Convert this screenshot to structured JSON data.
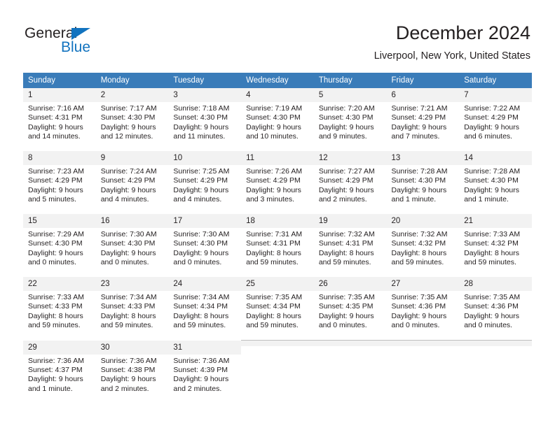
{
  "brand": {
    "name_part1": "General",
    "name_part2": "Blue",
    "accent_color": "#1273bf"
  },
  "header": {
    "month_title": "December 2024",
    "location": "Liverpool, New York, United States"
  },
  "theme": {
    "header_row_bg": "#3a7cb9",
    "daynum_bg": "#f2f2f2",
    "grid_line": "#bfbfbf",
    "text": "#231f20"
  },
  "weekdays": [
    "Sunday",
    "Monday",
    "Tuesday",
    "Wednesday",
    "Thursday",
    "Friday",
    "Saturday"
  ],
  "weeks": [
    [
      {
        "day": "1",
        "sunrise": "Sunrise: 7:16 AM",
        "sunset": "Sunset: 4:31 PM",
        "daylight_line1": "Daylight: 9 hours",
        "daylight_line2": "and 14 minutes."
      },
      {
        "day": "2",
        "sunrise": "Sunrise: 7:17 AM",
        "sunset": "Sunset: 4:30 PM",
        "daylight_line1": "Daylight: 9 hours",
        "daylight_line2": "and 12 minutes."
      },
      {
        "day": "3",
        "sunrise": "Sunrise: 7:18 AM",
        "sunset": "Sunset: 4:30 PM",
        "daylight_line1": "Daylight: 9 hours",
        "daylight_line2": "and 11 minutes."
      },
      {
        "day": "4",
        "sunrise": "Sunrise: 7:19 AM",
        "sunset": "Sunset: 4:30 PM",
        "daylight_line1": "Daylight: 9 hours",
        "daylight_line2": "and 10 minutes."
      },
      {
        "day": "5",
        "sunrise": "Sunrise: 7:20 AM",
        "sunset": "Sunset: 4:30 PM",
        "daylight_line1": "Daylight: 9 hours",
        "daylight_line2": "and 9 minutes."
      },
      {
        "day": "6",
        "sunrise": "Sunrise: 7:21 AM",
        "sunset": "Sunset: 4:29 PM",
        "daylight_line1": "Daylight: 9 hours",
        "daylight_line2": "and 7 minutes."
      },
      {
        "day": "7",
        "sunrise": "Sunrise: 7:22 AM",
        "sunset": "Sunset: 4:29 PM",
        "daylight_line1": "Daylight: 9 hours",
        "daylight_line2": "and 6 minutes."
      }
    ],
    [
      {
        "day": "8",
        "sunrise": "Sunrise: 7:23 AM",
        "sunset": "Sunset: 4:29 PM",
        "daylight_line1": "Daylight: 9 hours",
        "daylight_line2": "and 5 minutes."
      },
      {
        "day": "9",
        "sunrise": "Sunrise: 7:24 AM",
        "sunset": "Sunset: 4:29 PM",
        "daylight_line1": "Daylight: 9 hours",
        "daylight_line2": "and 4 minutes."
      },
      {
        "day": "10",
        "sunrise": "Sunrise: 7:25 AM",
        "sunset": "Sunset: 4:29 PM",
        "daylight_line1": "Daylight: 9 hours",
        "daylight_line2": "and 4 minutes."
      },
      {
        "day": "11",
        "sunrise": "Sunrise: 7:26 AM",
        "sunset": "Sunset: 4:29 PM",
        "daylight_line1": "Daylight: 9 hours",
        "daylight_line2": "and 3 minutes."
      },
      {
        "day": "12",
        "sunrise": "Sunrise: 7:27 AM",
        "sunset": "Sunset: 4:29 PM",
        "daylight_line1": "Daylight: 9 hours",
        "daylight_line2": "and 2 minutes."
      },
      {
        "day": "13",
        "sunrise": "Sunrise: 7:28 AM",
        "sunset": "Sunset: 4:30 PM",
        "daylight_line1": "Daylight: 9 hours",
        "daylight_line2": "and 1 minute."
      },
      {
        "day": "14",
        "sunrise": "Sunrise: 7:28 AM",
        "sunset": "Sunset: 4:30 PM",
        "daylight_line1": "Daylight: 9 hours",
        "daylight_line2": "and 1 minute."
      }
    ],
    [
      {
        "day": "15",
        "sunrise": "Sunrise: 7:29 AM",
        "sunset": "Sunset: 4:30 PM",
        "daylight_line1": "Daylight: 9 hours",
        "daylight_line2": "and 0 minutes."
      },
      {
        "day": "16",
        "sunrise": "Sunrise: 7:30 AM",
        "sunset": "Sunset: 4:30 PM",
        "daylight_line1": "Daylight: 9 hours",
        "daylight_line2": "and 0 minutes."
      },
      {
        "day": "17",
        "sunrise": "Sunrise: 7:30 AM",
        "sunset": "Sunset: 4:30 PM",
        "daylight_line1": "Daylight: 9 hours",
        "daylight_line2": "and 0 minutes."
      },
      {
        "day": "18",
        "sunrise": "Sunrise: 7:31 AM",
        "sunset": "Sunset: 4:31 PM",
        "daylight_line1": "Daylight: 8 hours",
        "daylight_line2": "and 59 minutes."
      },
      {
        "day": "19",
        "sunrise": "Sunrise: 7:32 AM",
        "sunset": "Sunset: 4:31 PM",
        "daylight_line1": "Daylight: 8 hours",
        "daylight_line2": "and 59 minutes."
      },
      {
        "day": "20",
        "sunrise": "Sunrise: 7:32 AM",
        "sunset": "Sunset: 4:32 PM",
        "daylight_line1": "Daylight: 8 hours",
        "daylight_line2": "and 59 minutes."
      },
      {
        "day": "21",
        "sunrise": "Sunrise: 7:33 AM",
        "sunset": "Sunset: 4:32 PM",
        "daylight_line1": "Daylight: 8 hours",
        "daylight_line2": "and 59 minutes."
      }
    ],
    [
      {
        "day": "22",
        "sunrise": "Sunrise: 7:33 AM",
        "sunset": "Sunset: 4:33 PM",
        "daylight_line1": "Daylight: 8 hours",
        "daylight_line2": "and 59 minutes."
      },
      {
        "day": "23",
        "sunrise": "Sunrise: 7:34 AM",
        "sunset": "Sunset: 4:33 PM",
        "daylight_line1": "Daylight: 8 hours",
        "daylight_line2": "and 59 minutes."
      },
      {
        "day": "24",
        "sunrise": "Sunrise: 7:34 AM",
        "sunset": "Sunset: 4:34 PM",
        "daylight_line1": "Daylight: 8 hours",
        "daylight_line2": "and 59 minutes."
      },
      {
        "day": "25",
        "sunrise": "Sunrise: 7:35 AM",
        "sunset": "Sunset: 4:34 PM",
        "daylight_line1": "Daylight: 8 hours",
        "daylight_line2": "and 59 minutes."
      },
      {
        "day": "26",
        "sunrise": "Sunrise: 7:35 AM",
        "sunset": "Sunset: 4:35 PM",
        "daylight_line1": "Daylight: 9 hours",
        "daylight_line2": "and 0 minutes."
      },
      {
        "day": "27",
        "sunrise": "Sunrise: 7:35 AM",
        "sunset": "Sunset: 4:36 PM",
        "daylight_line1": "Daylight: 9 hours",
        "daylight_line2": "and 0 minutes."
      },
      {
        "day": "28",
        "sunrise": "Sunrise: 7:35 AM",
        "sunset": "Sunset: 4:36 PM",
        "daylight_line1": "Daylight: 9 hours",
        "daylight_line2": "and 0 minutes."
      }
    ],
    [
      {
        "day": "29",
        "sunrise": "Sunrise: 7:36 AM",
        "sunset": "Sunset: 4:37 PM",
        "daylight_line1": "Daylight: 9 hours",
        "daylight_line2": "and 1 minute."
      },
      {
        "day": "30",
        "sunrise": "Sunrise: 7:36 AM",
        "sunset": "Sunset: 4:38 PM",
        "daylight_line1": "Daylight: 9 hours",
        "daylight_line2": "and 2 minutes."
      },
      {
        "day": "31",
        "sunrise": "Sunrise: 7:36 AM",
        "sunset": "Sunset: 4:39 PM",
        "daylight_line1": "Daylight: 9 hours",
        "daylight_line2": "and 2 minutes."
      },
      {
        "day": "",
        "sunrise": "",
        "sunset": "",
        "daylight_line1": "",
        "daylight_line2": ""
      },
      {
        "day": "",
        "sunrise": "",
        "sunset": "",
        "daylight_line1": "",
        "daylight_line2": ""
      },
      {
        "day": "",
        "sunrise": "",
        "sunset": "",
        "daylight_line1": "",
        "daylight_line2": ""
      },
      {
        "day": "",
        "sunrise": "",
        "sunset": "",
        "daylight_line1": "",
        "daylight_line2": ""
      }
    ]
  ]
}
